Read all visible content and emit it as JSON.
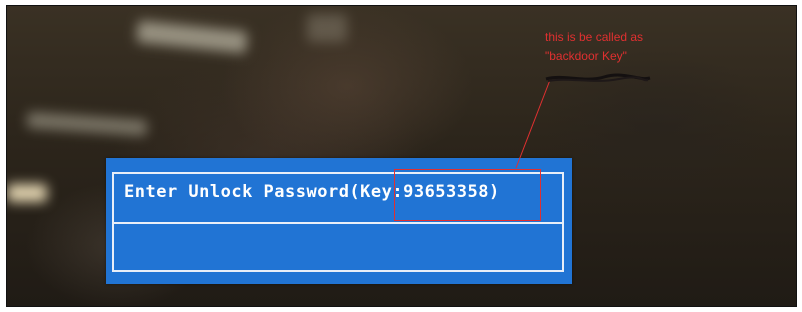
{
  "dialog": {
    "prompt": "Enter Unlock Password(Key:93653358)",
    "password_value": ""
  },
  "annotation": {
    "line1": "this is be called as",
    "line2": "\"backdoor Key\"",
    "color": "#e03030"
  },
  "colors": {
    "dialog_blue": "#2174d4",
    "dialog_border": "#e8eef8"
  }
}
